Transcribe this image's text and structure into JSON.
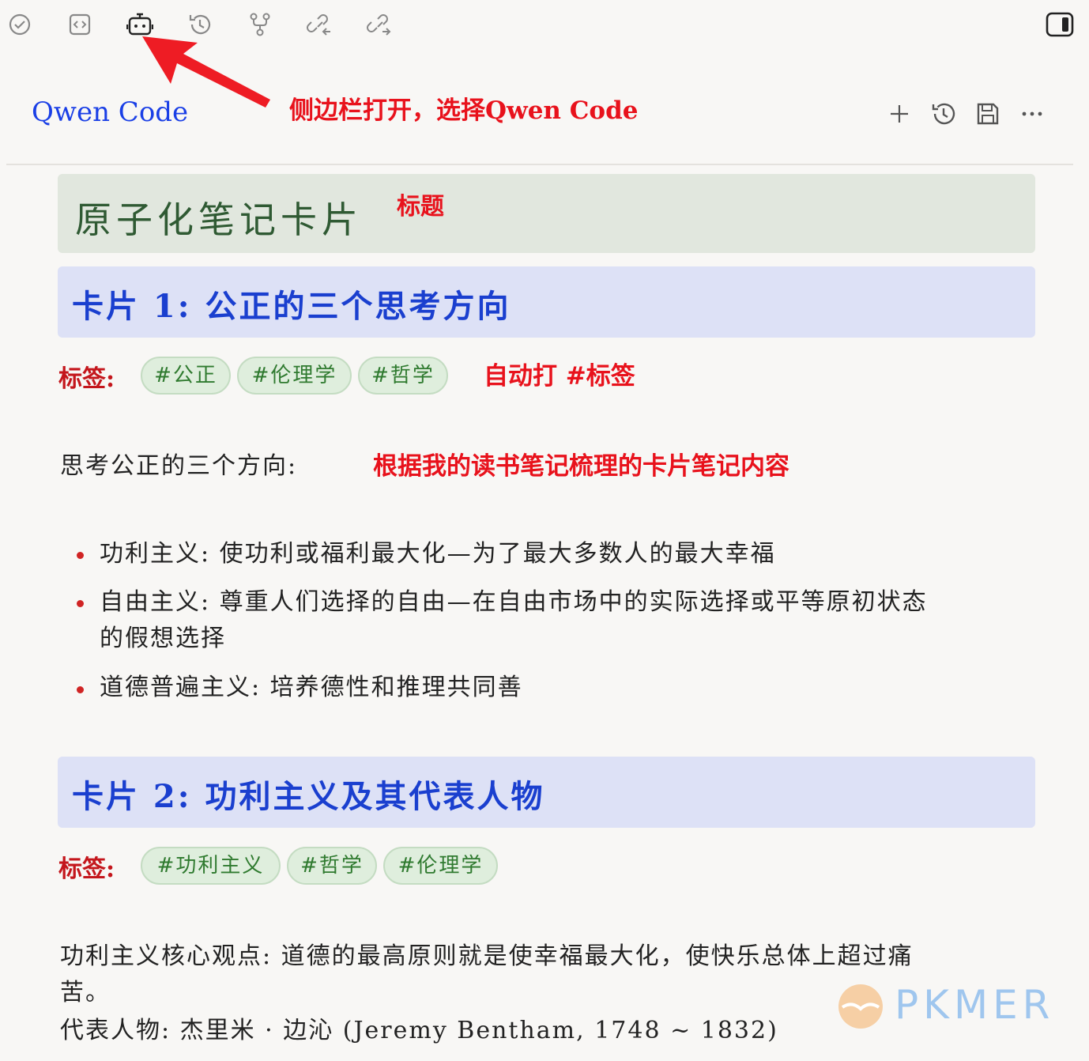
{
  "toolbar": {
    "icons": [
      "check-circle-icon",
      "code-icon",
      "bot-icon",
      "history-icon",
      "git-fork-icon",
      "link-back-icon",
      "link-forward-icon"
    ],
    "right_icon": "sidebar-toggle-icon"
  },
  "panel": {
    "title": "Qwen Code",
    "actions": [
      "plus-icon",
      "history-icon",
      "save-icon",
      "more-icon"
    ]
  },
  "annotations": {
    "sidebar": "侧边栏打开，选择Qwen Code",
    "title": "标题",
    "tags": "自动打 #标签",
    "content": "根据我的读书笔记梳理的卡片笔记内容"
  },
  "note": {
    "title": "原子化笔记卡片",
    "card1": {
      "heading": "卡片 1: 公正的三个思考方向",
      "tag_label": "标签:",
      "tags": [
        "#公正",
        "#伦理学",
        "#哲学"
      ],
      "intro": "思考公正的三个方向:",
      "bullets": [
        "功利主义: 使功利或福利最大化—为了最大多数人的最大幸福",
        "自由主义: 尊重人们选择的自由—在自由市场中的实际选择或平等原初状态",
        "的假想选择",
        "道德普遍主义: 培养德性和推理共同善"
      ]
    },
    "card2": {
      "heading": "卡片 2: 功利主义及其代表人物",
      "tag_label": "标签:",
      "tags": [
        "#功利主义",
        "#哲学",
        "#伦理学"
      ],
      "para_line1": "功利主义核心观点: 道德的最高原则就是使幸福最大化，使快乐总体上超过痛",
      "para_line2": "苦。",
      "para_line3": "代表人物: 杰里米 · 边沁 (Jeremy Bentham, 1748 ~ 1832)"
    }
  },
  "watermark": "PKMER",
  "colors": {
    "annotation": "#e8121c",
    "panel_title": "#1a3fe6",
    "heading": "#1a3fcf",
    "tag_text": "#2f7a2f",
    "tag_label": "#c4161c"
  }
}
